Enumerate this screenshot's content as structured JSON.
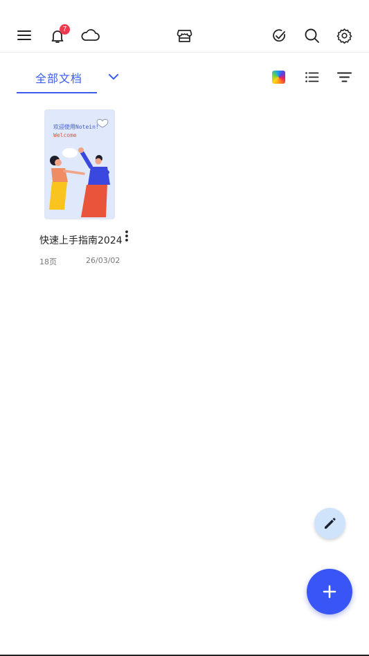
{
  "topbar": {
    "notification_count": "7",
    "icons": [
      "menu-icon",
      "bell-icon",
      "cloud-icon",
      "store-icon",
      "check-circle-icon",
      "search-icon",
      "settings-icon"
    ]
  },
  "filter": {
    "tab_label": "全部文档",
    "accent_color": "#3b5bf0"
  },
  "documents": [
    {
      "title": "快速上手指南2024",
      "pages": "18页",
      "date": "26/03/02",
      "thumbnail": {
        "heading": "欢迎使用Notein!",
        "subheading": "Welcome"
      }
    }
  ],
  "fab": {
    "secondary_icon": "pencil-icon",
    "primary_icon": "plus-icon",
    "primary_color": "#3a55f5"
  }
}
